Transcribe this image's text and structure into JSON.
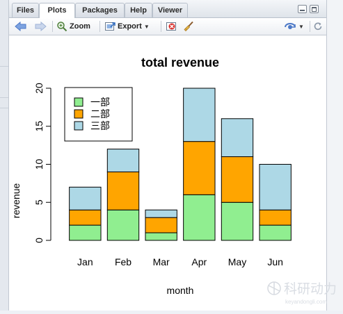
{
  "tabs": [
    {
      "label": "Files",
      "active": false
    },
    {
      "label": "Plots",
      "active": true
    },
    {
      "label": "Packages",
      "active": false
    },
    {
      "label": "Help",
      "active": false
    },
    {
      "label": "Viewer",
      "active": false
    }
  ],
  "toolbar": {
    "zoom_label": "Zoom",
    "export_label": "Export",
    "icons": [
      "back-arrow-icon",
      "forward-arrow-icon",
      "zoom-icon",
      "export-icon",
      "remove-plot-icon",
      "broom-icon",
      "publish-icon",
      "refresh-icon"
    ]
  },
  "colors": {
    "series1": "#90EE90",
    "series2": "#FFA500",
    "series3": "#ADD8E6",
    "toolbar_blue": "#4d79c7"
  },
  "chart_data": {
    "type": "bar",
    "stacked": true,
    "title": "total revenue",
    "xlabel": "month",
    "ylabel": "revenue",
    "categories": [
      "Jan",
      "Feb",
      "Mar",
      "Apr",
      "May",
      "Jun"
    ],
    "series": [
      {
        "name": "一部",
        "color": "#90EE90",
        "values": [
          2,
          4,
          1,
          6,
          5,
          2
        ]
      },
      {
        "name": "二部",
        "color": "#FFA500",
        "values": [
          2,
          5,
          2,
          7,
          6,
          2
        ]
      },
      {
        "name": "三部",
        "color": "#ADD8E6",
        "values": [
          3,
          3,
          1,
          7,
          5,
          6
        ]
      }
    ],
    "ylim": [
      0,
      20
    ],
    "yticks": [
      0,
      5,
      10,
      15,
      20
    ],
    "grid": false,
    "legend_position": "top-left"
  },
  "watermark": {
    "text": "科研动力",
    "subtext": "keyandongli.com"
  }
}
